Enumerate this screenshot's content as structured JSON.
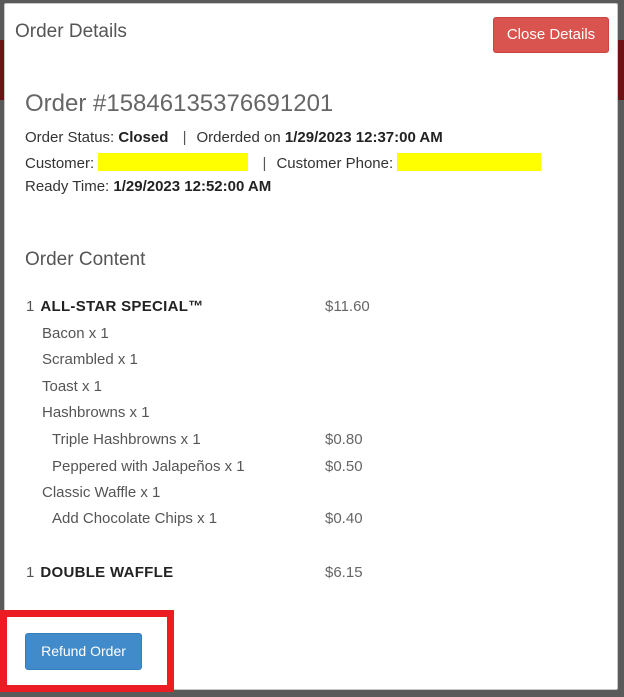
{
  "modal": {
    "title": "Order Details",
    "close_label": "Close Details"
  },
  "order": {
    "number": "Order #15846135376691201",
    "status_label": "Order Status:",
    "status_value": "Closed",
    "separator": "|",
    "ordered_label": "Orderded on",
    "ordered_value": "1/29/2023 12:37:00 AM",
    "customer_label": "Customer:",
    "phone_label": "Customer Phone:",
    "ready_label": "Ready Time:",
    "ready_value": "1/29/2023 12:52:00 AM"
  },
  "content": {
    "title": "Order Content",
    "items": [
      {
        "qty": "1",
        "name": "ALL-STAR SPECIAL™",
        "price": "$11.60",
        "level": 0
      },
      {
        "name": "Bacon x 1",
        "price": "",
        "level": 1
      },
      {
        "name": "Scrambled x 1",
        "price": "",
        "level": 1
      },
      {
        "name": "Toast x 1",
        "price": "",
        "level": 1
      },
      {
        "name": "Hashbrowns x 1",
        "price": "",
        "level": 1
      },
      {
        "name": "Triple Hashbrowns x 1",
        "price": "$0.80",
        "level": 2
      },
      {
        "name": "Peppered with Jalapeños x 1",
        "price": "$0.50",
        "level": 2
      },
      {
        "name": "Classic Waffle x 1",
        "price": "",
        "level": 1
      },
      {
        "name": "Add Chocolate Chips x 1",
        "price": "$0.40",
        "level": 2
      },
      {
        "qty": "1",
        "name": "DOUBLE WAFFLE",
        "price": "$6.15",
        "level": 0
      }
    ]
  },
  "actions": {
    "refund_label": "Refund Order"
  },
  "colors": {
    "close_button": "#d9534f",
    "refund_button": "#428bca",
    "highlight": "#ec1c24",
    "redaction": "#ffff00"
  }
}
